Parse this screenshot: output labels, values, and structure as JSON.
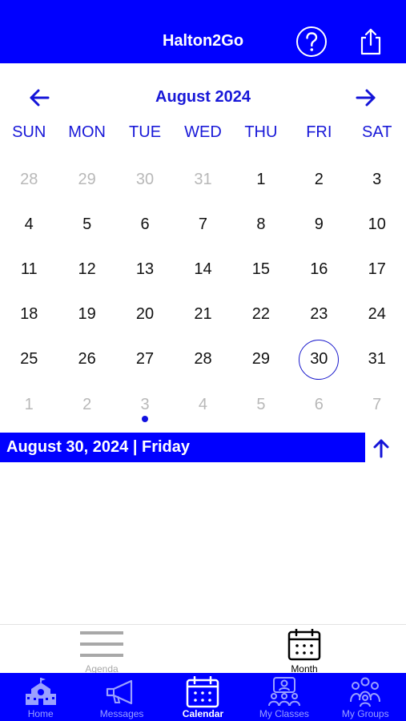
{
  "header": {
    "title": "Halton2Go"
  },
  "calendar": {
    "month_title": "August 2024",
    "weekdays": [
      "SUN",
      "MON",
      "TUE",
      "WED",
      "THU",
      "FRI",
      "SAT"
    ],
    "weeks": [
      [
        {
          "d": "28",
          "other": true
        },
        {
          "d": "29",
          "other": true
        },
        {
          "d": "30",
          "other": true
        },
        {
          "d": "31",
          "other": true
        },
        {
          "d": "1"
        },
        {
          "d": "2"
        },
        {
          "d": "3"
        }
      ],
      [
        {
          "d": "4"
        },
        {
          "d": "5"
        },
        {
          "d": "6"
        },
        {
          "d": "7"
        },
        {
          "d": "8"
        },
        {
          "d": "9"
        },
        {
          "d": "10"
        }
      ],
      [
        {
          "d": "11"
        },
        {
          "d": "12"
        },
        {
          "d": "13"
        },
        {
          "d": "14"
        },
        {
          "d": "15"
        },
        {
          "d": "16"
        },
        {
          "d": "17"
        }
      ],
      [
        {
          "d": "18"
        },
        {
          "d": "19"
        },
        {
          "d": "20"
        },
        {
          "d": "21"
        },
        {
          "d": "22"
        },
        {
          "d": "23"
        },
        {
          "d": "24"
        }
      ],
      [
        {
          "d": "25"
        },
        {
          "d": "26"
        },
        {
          "d": "27"
        },
        {
          "d": "28"
        },
        {
          "d": "29"
        },
        {
          "d": "30",
          "selected": true
        },
        {
          "d": "31"
        }
      ],
      [
        {
          "d": "1",
          "other": true
        },
        {
          "d": "2",
          "other": true
        },
        {
          "d": "3",
          "other": true,
          "event": true
        },
        {
          "d": "4",
          "other": true
        },
        {
          "d": "5",
          "other": true
        },
        {
          "d": "6",
          "other": true
        },
        {
          "d": "7",
          "other": true
        }
      ]
    ],
    "selected_date_label": "August 30, 2024 | Friday"
  },
  "view_toggle": {
    "agenda_label": "Agenda",
    "month_label": "Month",
    "active": "Month"
  },
  "tabbar": {
    "tabs": [
      {
        "label": "Home",
        "icon": "school-icon"
      },
      {
        "label": "Messages",
        "icon": "megaphone-icon"
      },
      {
        "label": "Calendar",
        "icon": "calendar-icon",
        "active": true
      },
      {
        "label": "My Classes",
        "icon": "classes-icon"
      },
      {
        "label": "My Groups",
        "icon": "groups-icon"
      }
    ]
  },
  "colors": {
    "brand": "#0000ff",
    "accent_text": "#1818d8",
    "muted": "#b8b8b8"
  }
}
